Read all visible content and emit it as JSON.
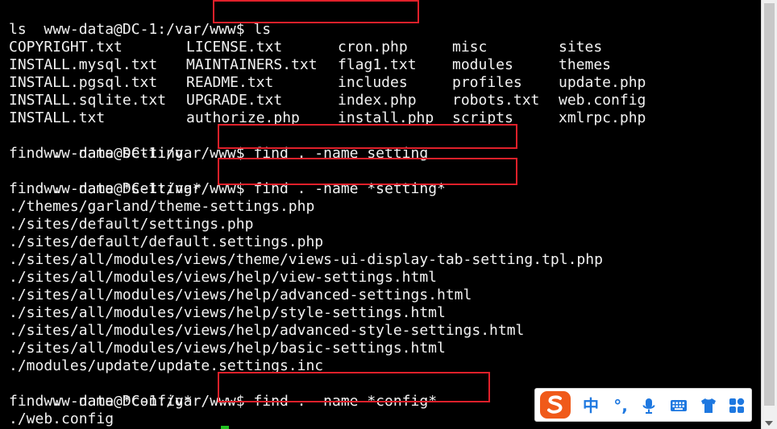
{
  "colors": {
    "background": "#000000",
    "foreground": "#f2f2f2",
    "annotation_box": "#e0202a",
    "cursor": "#20c020",
    "ime_accent": "#1e78e0",
    "ime_logo": "#f05a1a"
  },
  "terminal": {
    "lines": {
      "prompt1": "www-data@DC-1:/var/www$",
      "cmd1": "ls",
      "echo1": "ls",
      "prompt2": "www-data@DC-1:/var/www$",
      "cmd2": "find . -name setting",
      "echo2": "find . -name setting",
      "prompt3": "www-data@DC-1:/var/www$",
      "cmd3": "find . -name *setting*",
      "echo3": "find . -name *setting*",
      "prompt4": "www-data@DC-1:/var/www$",
      "cmd4": "find . -name *config*",
      "echo4": "find . -name *config*"
    },
    "ls_listing": [
      [
        "COPYRIGHT.txt",
        "LICENSE.txt",
        "cron.php",
        "misc",
        "sites"
      ],
      [
        "INSTALL.mysql.txt",
        "MAINTAINERS.txt",
        "flag1.txt",
        "modules",
        "themes"
      ],
      [
        "INSTALL.pgsql.txt",
        "README.txt",
        "includes",
        "profiles",
        "update.php"
      ],
      [
        "INSTALL.sqlite.txt",
        "UPGRADE.txt",
        "index.php",
        "robots.txt",
        "web.config"
      ],
      [
        "INSTALL.txt",
        "authorize.php",
        "install.php",
        "scripts",
        "xmlrpc.php"
      ]
    ],
    "setting_results": [
      "./themes/garland/theme-settings.php",
      "./sites/default/settings.php",
      "./sites/default/default.settings.php",
      "./sites/all/modules/views/theme/views-ui-display-tab-setting.tpl.php",
      "./sites/all/modules/views/help/view-settings.html",
      "./sites/all/modules/views/help/advanced-settings.html",
      "./sites/all/modules/views/help/style-settings.html",
      "./sites/all/modules/views/help/advanced-style-settings.html",
      "./sites/all/modules/views/help/basic-settings.html",
      "./modules/update/update.settings.inc"
    ],
    "config_results": [
      "./web.config"
    ]
  },
  "ime_toolbar": {
    "logo_icon": "sogou-s-logo-icon",
    "chinese_mode": "中",
    "punctuation": "°,",
    "icons": [
      "microphone-icon",
      "keyboard-icon",
      "shirt-skin-icon",
      "grid-toolbox-icon"
    ]
  }
}
